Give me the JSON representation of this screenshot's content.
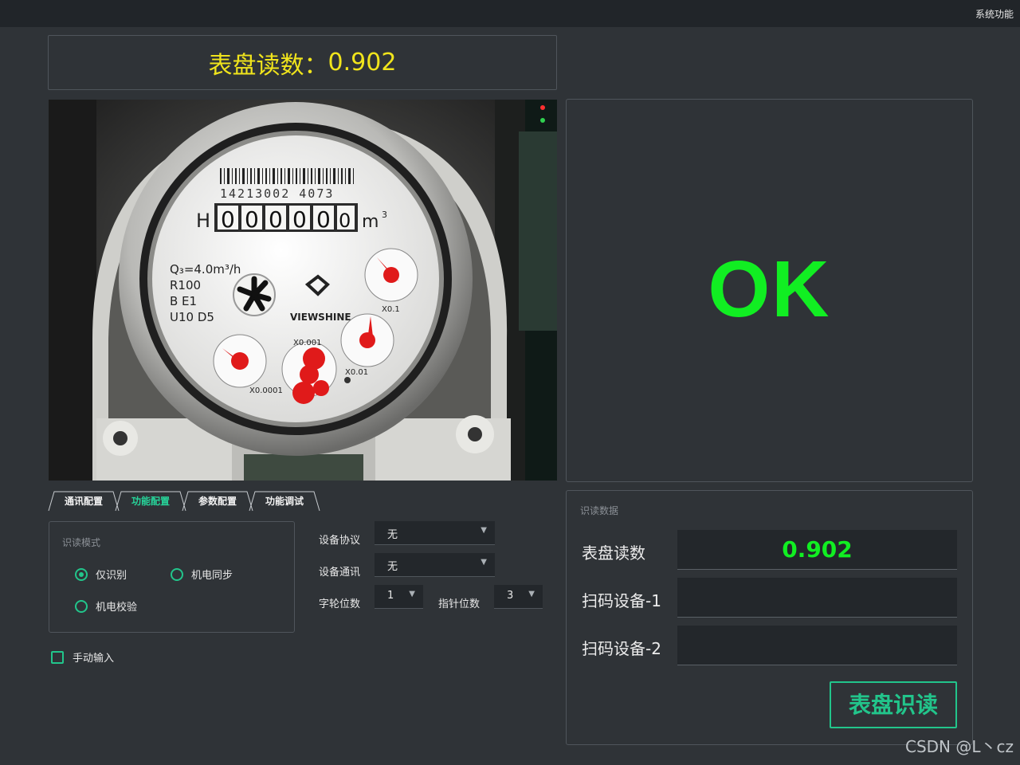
{
  "top_bar": {
    "menu": "系统功能"
  },
  "reading_banner": {
    "label": "表盘读数：",
    "value": "0.902"
  },
  "camera_image": {
    "serial": "14213002 4073",
    "counter_prefix": "H",
    "counter_digits": [
      "0",
      "0",
      "0",
      "0",
      "0",
      "0"
    ],
    "unit_m": "m",
    "unit_sup": "3",
    "spec_lines": [
      "Q₃=4.0m³/h",
      "R100",
      "B E1",
      "U10 D5"
    ],
    "brand": "VIEWSHINE",
    "dial_labels": [
      "X0.1",
      "X0.01",
      "X0.001",
      "X0.0001"
    ]
  },
  "result": {
    "status": "OK",
    "status_color": "#11ee22"
  },
  "tabs": [
    {
      "label": "通讯配置",
      "active": false
    },
    {
      "label": "功能配置",
      "active": true
    },
    {
      "label": "参数配置",
      "active": false
    },
    {
      "label": "功能调试",
      "active": false
    }
  ],
  "mode_group": {
    "title": "识读模式",
    "options": [
      {
        "label": "仅识别",
        "checked": true
      },
      {
        "label": "机电同步",
        "checked": false
      },
      {
        "label": "机电校验",
        "checked": false
      }
    ]
  },
  "manual_input": {
    "label": "手动输入",
    "checked": false
  },
  "settings": {
    "protocol_label": "设备协议",
    "protocol_value": "无",
    "comm_label": "设备通讯",
    "comm_value": "无",
    "wheel_label": "字轮位数",
    "wheel_value": "1",
    "pointer_label": "指针位数",
    "pointer_value": "3"
  },
  "data_panel": {
    "title": "识读数据",
    "rows": [
      {
        "label": "表盘读数",
        "value": "0.902"
      },
      {
        "label": "扫码设备-1",
        "value": ""
      },
      {
        "label": "扫码设备-2",
        "value": ""
      }
    ],
    "button": "表盘识读"
  },
  "watermark": "CSDN @L丶cz",
  "accent_color": "#22c58b"
}
